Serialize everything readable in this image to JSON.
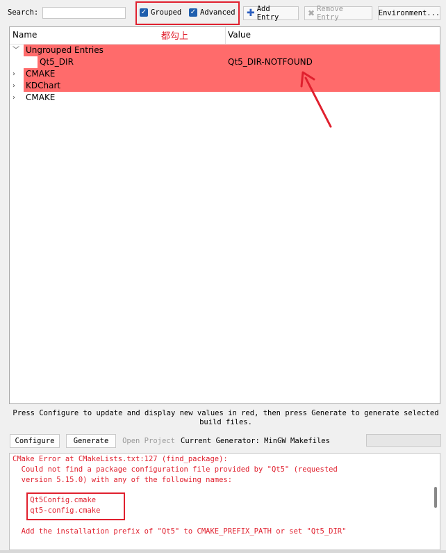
{
  "toolbar": {
    "search_label": "Search:",
    "search_value": "",
    "grouped_label": "Grouped",
    "grouped_checked": true,
    "advanced_label": "Advanced",
    "advanced_checked": true,
    "add_entry_label": "Add Entry",
    "remove_entry_label": "Remove Entry",
    "environment_label": "Environment..."
  },
  "tree": {
    "columns": [
      "Name",
      "Value"
    ],
    "annotation": "都勾上",
    "rows": [
      {
        "label": "Ungrouped Entries",
        "expanded": true,
        "highlight": true
      },
      {
        "label": "Qt5_DIR",
        "value": "Qt5_DIR-NOTFOUND",
        "highlight": true
      },
      {
        "label": "CMAKE",
        "expanded": false,
        "highlight": true
      },
      {
        "label": "KDChart",
        "expanded": false,
        "highlight": true
      },
      {
        "label": "CMAKE",
        "expanded": false,
        "highlight": false
      }
    ]
  },
  "status": "Press Configure to update and display new values in red, then press Generate to generate selected build files.",
  "buttons": {
    "configure": "Configure",
    "generate": "Generate",
    "open_project": "Open Project"
  },
  "generator": "Current Generator: MinGW Makefiles",
  "progress": 0,
  "colors": {
    "highlight": "#ff6b6b",
    "error": "#e0202e",
    "accent": "#1f5fae"
  },
  "output": [
    "CMake Error at CMakeLists.txt:127 (find_package):",
    "  Could not find a package configuration file provided by \"Qt5\" (requested",
    "  version 5.15.0) with any of the following names:",
    "",
    "    Qt5Config.cmake",
    "    qt5-config.cmake",
    "",
    "  Add the installation prefix of \"Qt5\" to CMAKE_PREFIX_PATH or set \"Qt5_DIR\""
  ]
}
